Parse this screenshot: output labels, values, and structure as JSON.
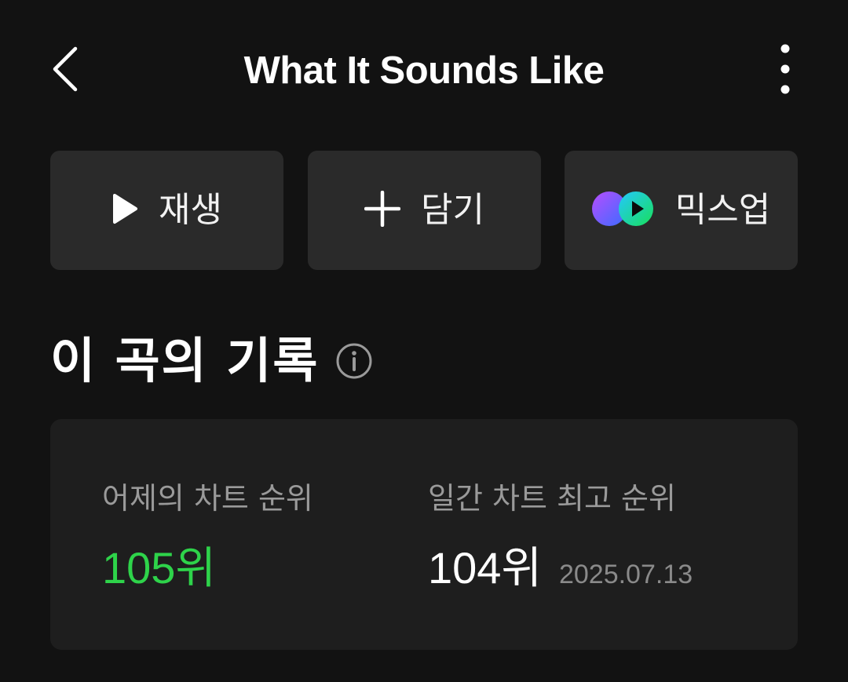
{
  "header": {
    "title": "What It Sounds Like",
    "back_icon": "chevron-left-icon",
    "more_icon": "more-vertical-icon"
  },
  "actions": {
    "play_label": "재생",
    "add_label": "담기",
    "mixup_label": "믹스업"
  },
  "section": {
    "title": "이 곡의 기록",
    "info_icon": "info-icon"
  },
  "record": {
    "yesterday_label": "어제의 차트 순위",
    "yesterday_value": "105위",
    "best_label": "일간 차트 최고 순위",
    "best_value": "104위",
    "best_date": "2025.07.13"
  },
  "colors": {
    "background": "#121212",
    "button_bg": "#2a2a2a",
    "card_bg": "#1e1e1e",
    "accent_green": "#2ed34a",
    "muted_text": "#9a9a9a"
  }
}
